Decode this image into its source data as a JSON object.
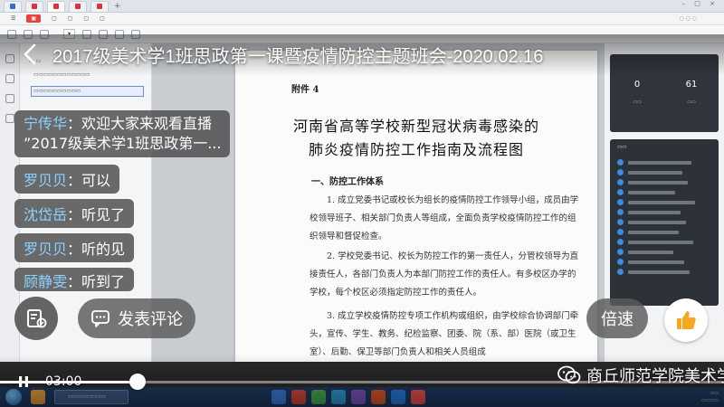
{
  "live": {
    "title": "2017级美术学1班思政第一课暨疫情防控主题班会-2020.02.16"
  },
  "comments": [
    {
      "nick": "宁传华",
      "sep": "：",
      "text_line1": "欢迎大家来观看直播",
      "text_line2": "”2017级美术学1班思政第一..."
    },
    {
      "nick": "罗贝贝",
      "sep": "：",
      "text": "可以"
    },
    {
      "nick": "沈岱岳",
      "sep": "：",
      "text": "听见了"
    },
    {
      "nick": "罗贝贝",
      "sep": "：",
      "text": "听的见"
    },
    {
      "nick": "顾静雯",
      "sep": "：",
      "text": "听到了"
    }
  ],
  "actions": {
    "comment_label": "发表评论",
    "speed_label": "倍速"
  },
  "player": {
    "current_time": "03:00",
    "progress": 0.19
  },
  "watermark": {
    "text": "商丘师范学院美术学院"
  },
  "document": {
    "attachment": "附件 4",
    "title_line1": "河南省高等学校新型冠状病毒感染的",
    "title_line2": "肺炎疫情防控工作指南及流程图",
    "section1": "一、防控工作体系",
    "para1": "1. 成立党委书记或校长为组长的疫情防控工作领导小组，成员由学校领导班子、相关部门负责人等组成，全面负责学校疫情防控工作的组织领导和督促检查。",
    "para2": "2. 学校党委书记、校长为防控工作的第一责任人，分管校领导为直接责任人，各部门负责人为本部门防控工作的责任人。有多校区办学的学校，每个校区必须指定防控工作的责任人。",
    "para3": "3. 成立学校疫情防控专项工作机构或组织，由学校综合协调部门牵头，宣传、学生、教务、纪检监察、团委、院（系、部）医院（或卫生室）、后勤、保卫等部门负责人和相关人员组成"
  },
  "sidepanel": {
    "count_left": "0",
    "count_right": "61"
  },
  "colors": {
    "nick": "#8bd3ff",
    "like_accent": "#f5a623"
  }
}
